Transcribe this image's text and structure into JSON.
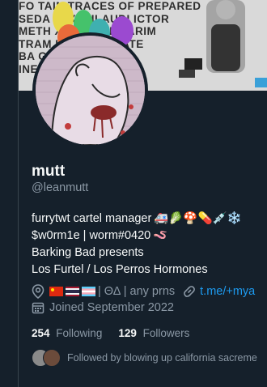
{
  "banner": {
    "text_lines": [
      "FO          TAIN TRACES OF PREPARED",
      "SEDA    I        AX, DILAUDI   ICTOR",
      "METH          XYCODONE,     ARIM",
      "TRAM              KETAMIN      PIATE",
      "BA              GHB       ON",
      "                            INE, COCAINE PO"
    ]
  },
  "profile": {
    "name": "mutt",
    "handle": "@leanmutt",
    "bio": {
      "line1": "furrytwt cartel manager",
      "line1_emojis": "🚑🥬🍄💊💉❄️",
      "line2": "$w0rm1e | worm#0420",
      "line2_emoji": "🪱",
      "line3": "Barking Bad presents",
      "line4": "Los Furtel / Los Perros Hormones"
    },
    "location": "| ΘΔ | any prns",
    "link": "t.me/+mya",
    "joined": "Joined September 2022",
    "following_count": "254",
    "following_label": "Following",
    "followers_count": "129",
    "followers_label": "Followers",
    "followed_by": "Followed by blowing up california sacreme"
  },
  "icons": {
    "location": "location-pin-icon",
    "link": "link-icon",
    "calendar": "calendar-icon"
  },
  "colors": {
    "background": "#15202b",
    "text": "#f7f9f9",
    "muted": "#8b98a5",
    "link": "#1d9bf0"
  }
}
